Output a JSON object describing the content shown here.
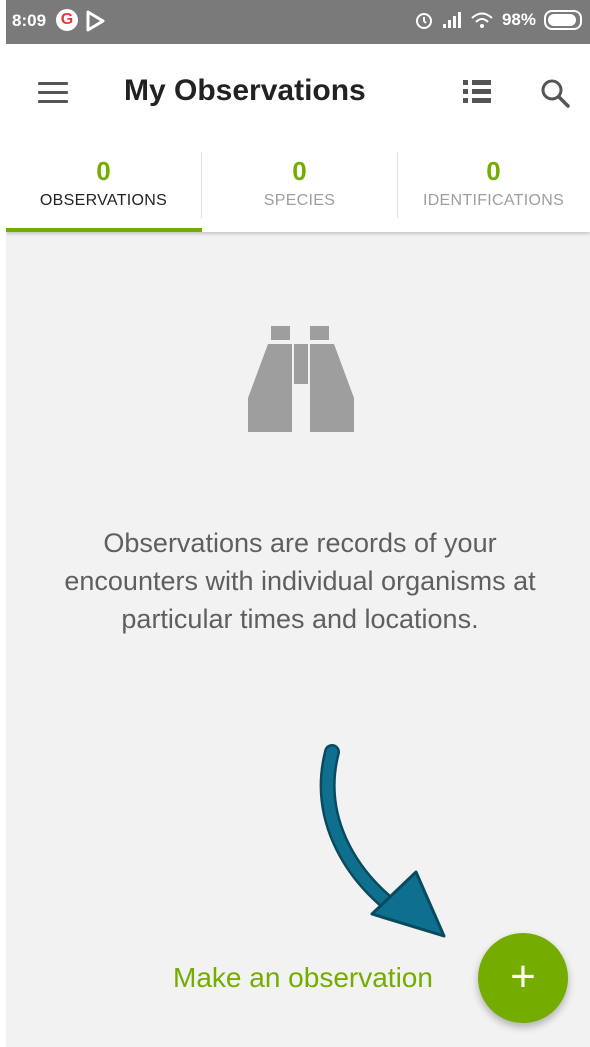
{
  "status_bar": {
    "time": "8:09",
    "battery": "98%"
  },
  "app_bar": {
    "title": "My Observations"
  },
  "tabs": [
    {
      "count": "0",
      "label": "OBSERVATIONS",
      "active": true
    },
    {
      "count": "0",
      "label": "SPECIES",
      "active": false
    },
    {
      "count": "0",
      "label": "IDENTIFICATIONS",
      "active": false
    }
  ],
  "empty_state": {
    "message": "Observations are records of your encounters with individual organisms at particular times and locations."
  },
  "cta": {
    "label": "Make an observation",
    "fab_symbol": "+"
  },
  "colors": {
    "accent": "#74ac00",
    "arrow": "#0f6f8f"
  }
}
